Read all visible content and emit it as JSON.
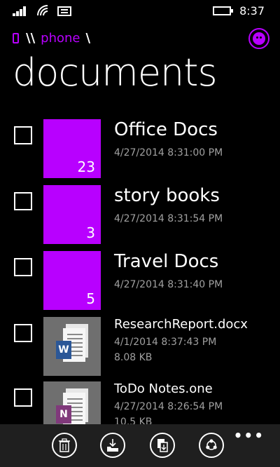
{
  "status": {
    "time": "8:37"
  },
  "breadcrumb": {
    "separator": "\\\\",
    "location": "phone",
    "trail": "\\"
  },
  "page": {
    "title": "documents"
  },
  "items": [
    {
      "name": "Office Docs",
      "date": "4/27/2014 8:31:00 PM",
      "count": "23"
    },
    {
      "name": "story books",
      "date": "4/27/2014 8:31:54 PM",
      "count": "3"
    },
    {
      "name": "Travel Docs",
      "date": "4/27/2014 8:31:40 PM",
      "count": "5"
    },
    {
      "name": "ResearchReport.docx",
      "date": "4/1/2014 8:37:43 PM",
      "size": "8.08 KB",
      "badge": "W"
    },
    {
      "name": "ToDo Notes.one",
      "date": "4/27/2014 8:26:54 PM",
      "size": "10.5 KB",
      "badge": "N"
    }
  ],
  "appbar": {
    "more": "•••"
  },
  "colors": {
    "accent": "#b800ff",
    "background": "#000000",
    "appbar": "#1f1f1f",
    "word": "#2b5797",
    "onenote": "#80397b"
  },
  "icons": [
    "signal-icon",
    "wifi-icon",
    "message-icon",
    "battery-icon",
    "phone-icon",
    "avatar-icon",
    "delete-icon",
    "open-icon",
    "copy-icon",
    "share-icon"
  ]
}
